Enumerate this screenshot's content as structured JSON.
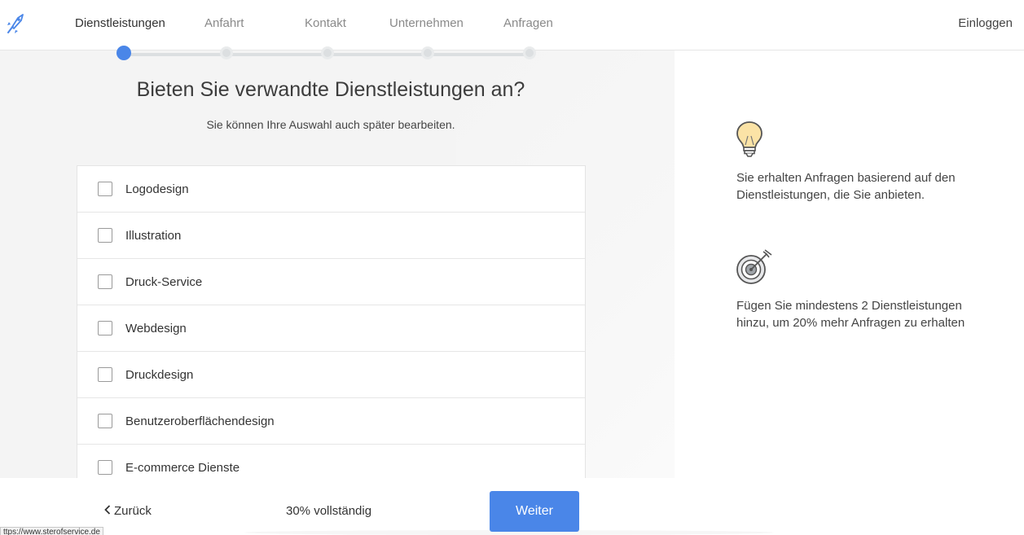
{
  "nav": {
    "items": [
      {
        "label": "Dienstleistungen",
        "active": true
      },
      {
        "label": "Anfahrt",
        "active": false
      },
      {
        "label": "Kontakt",
        "active": false
      },
      {
        "label": "Unternehmen",
        "active": false
      },
      {
        "label": "Anfragen",
        "active": false
      }
    ],
    "login": "Einloggen"
  },
  "progress": {
    "steps": 5,
    "current": 1
  },
  "main": {
    "title": "Bieten Sie verwandte Dienstleistungen an?",
    "subtitle": "Sie können Ihre Auswahl auch später bearbeiten.",
    "services": [
      {
        "label": "Logodesign",
        "checked": false
      },
      {
        "label": "Illustration",
        "checked": false
      },
      {
        "label": "Druck-Service",
        "checked": false
      },
      {
        "label": "Webdesign",
        "checked": false
      },
      {
        "label": "Druckdesign",
        "checked": false
      },
      {
        "label": "Benutzeroberflächendesign",
        "checked": false
      },
      {
        "label": "E-commerce Dienste",
        "checked": false
      }
    ]
  },
  "info": {
    "tip1": {
      "icon": "lightbulb-icon",
      "text": "Sie erhalten Anfragen basierend auf den Dienstleistungen, die Sie anbieten."
    },
    "tip2": {
      "icon": "target-icon",
      "text": "Fügen Sie mindestens 2 Dienstleistungen hinzu, um 20% mehr Anfragen zu erhalten"
    }
  },
  "footer": {
    "back": "Zurück",
    "progress_text": "30% vollständig",
    "next": "Weiter"
  },
  "status_bar": {
    "url": "ttps://www.sterofservice.de"
  },
  "colors": {
    "accent": "#4a86e8",
    "step_inactive": "#dcdfe1",
    "panel_bg": "#f4f4f4"
  }
}
